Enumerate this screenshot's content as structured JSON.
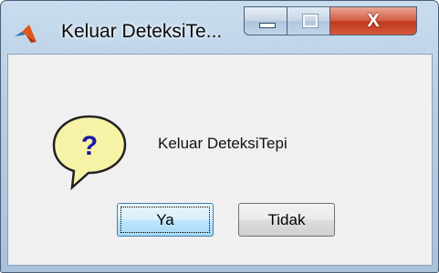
{
  "window": {
    "title": "Keluar DeteksiTe...",
    "controls": {
      "minimize_icon": "minimize-icon",
      "maximize_icon": "maximize-icon",
      "close_glyph": "X"
    }
  },
  "dialog": {
    "icon": "question-icon",
    "icon_glyph": "?",
    "message": "Keluar DeteksiTepi",
    "buttons": {
      "yes_label": "Ya",
      "no_label": "Tidak"
    }
  },
  "colors": {
    "question_bubble": "#f7f3a6",
    "question_mark": "#1a1aa8",
    "close_button": "#c7452a"
  }
}
